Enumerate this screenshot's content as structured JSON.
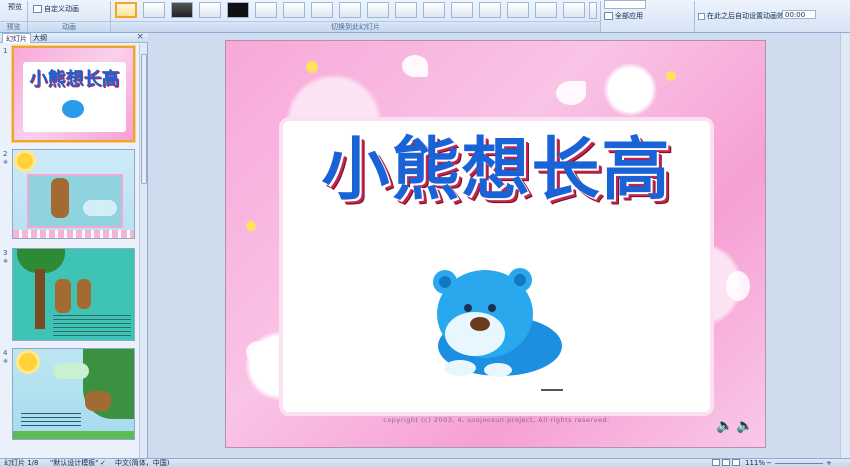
{
  "ribbon": {
    "preview_label": "预览",
    "custom_animation_label": "自定义动画",
    "group_preview": "预览",
    "group_animation": "动画",
    "group_transition": "切换到此幻灯片",
    "apply_all_label": "全部应用",
    "auto_after_label": "在此之后自动设置动画效果:",
    "auto_after_value": "00:00"
  },
  "left_pane": {
    "tabs": [
      "幻灯片",
      "大纲"
    ],
    "close_label": "×",
    "slides": [
      {
        "num": "1",
        "title": "小熊想长高"
      },
      {
        "num": "2"
      },
      {
        "num": "3"
      },
      {
        "num": "4"
      }
    ]
  },
  "slide": {
    "title": "小熊想长高",
    "copyright": "copyright (c) 2003, 4, soojoosun project, All rights reserved."
  },
  "status": {
    "slide_info": "幻灯片 1/8",
    "theme": "\"默认设计模板\"",
    "language": "中文(简体，中国)",
    "zoom": "111%"
  },
  "colors": {
    "title_blue": "#1a63d6",
    "title_shadow": "#c5264e",
    "slide_pink": "#f7a8d8",
    "selection_orange": "#f0a32d"
  }
}
